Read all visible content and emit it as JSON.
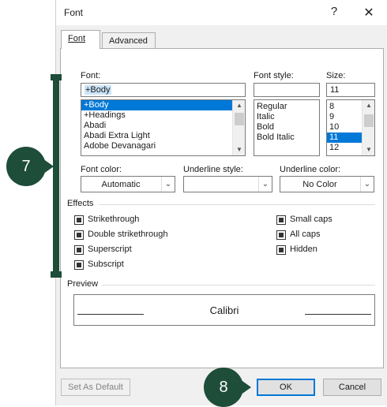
{
  "dialog": {
    "title": "Font",
    "help_glyph": "?",
    "close_glyph": "✕"
  },
  "tabs": [
    {
      "label": "Font",
      "active": true
    },
    {
      "label": "Advanced",
      "active": false
    }
  ],
  "font": {
    "label": "Font:",
    "value": "+Body",
    "items": [
      "+Body",
      "+Headings",
      "Abadi",
      "Abadi Extra Light",
      "Adobe Devanagari"
    ],
    "selected_index": 0
  },
  "font_style": {
    "label": "Font style:",
    "value": "",
    "items": [
      "Regular",
      "Italic",
      "Bold",
      "Bold Italic"
    ]
  },
  "size": {
    "label": "Size:",
    "value": "11",
    "items": [
      "8",
      "9",
      "10",
      "11",
      "12"
    ],
    "selected_index": 3
  },
  "font_color": {
    "label": "Font color:",
    "value": "Automatic"
  },
  "underline_style": {
    "label": "Underline style:",
    "value": ""
  },
  "underline_color": {
    "label": "Underline color:",
    "value": "No Color"
  },
  "effects": {
    "title": "Effects",
    "left": [
      "Strikethrough",
      "Double strikethrough",
      "Superscript",
      "Subscript"
    ],
    "right": [
      "Small caps",
      "All caps",
      "Hidden"
    ]
  },
  "preview": {
    "title": "Preview",
    "text": "Calibri"
  },
  "buttons": {
    "set_default": "Set As Default",
    "ok": "OK",
    "cancel": "Cancel"
  },
  "callouts": {
    "step7": "7",
    "step8": "8",
    "color": "#1e4d3a"
  },
  "icons": {
    "dropdown": "chevron-down-icon",
    "scroll_up": "scroll-up-icon",
    "scroll_down": "scroll-down-icon"
  }
}
